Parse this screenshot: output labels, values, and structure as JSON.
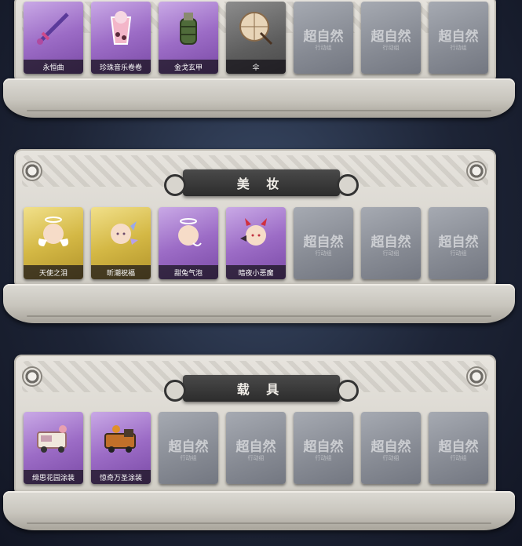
{
  "sections": [
    {
      "title": "",
      "items": [
        {
          "label": "永恒曲",
          "rarity": "purple",
          "icon": "sword-icon"
        },
        {
          "label": "珍珠音乐卷卷",
          "rarity": "purple",
          "icon": "drink-cup-icon"
        },
        {
          "label": "金戈玄甲",
          "rarity": "purple",
          "icon": "grenade-icon"
        },
        {
          "label": "伞",
          "rarity": "grey",
          "icon": "umbrella-icon"
        },
        {
          "label": "",
          "rarity": "empty",
          "icon": "watermark-icon"
        },
        {
          "label": "",
          "rarity": "empty",
          "icon": "watermark-icon"
        },
        {
          "label": "",
          "rarity": "empty",
          "icon": "watermark-icon"
        }
      ]
    },
    {
      "title": "美 妆",
      "items": [
        {
          "label": "天使之泪",
          "rarity": "gold",
          "icon": "angel-face-icon"
        },
        {
          "label": "昕潮祝福",
          "rarity": "gold",
          "icon": "crystal-face-icon"
        },
        {
          "label": "甜兔气泡",
          "rarity": "purple",
          "icon": "bunny-face-icon"
        },
        {
          "label": "暗夜小恶魔",
          "rarity": "purple",
          "icon": "devil-face-icon"
        },
        {
          "label": "",
          "rarity": "empty",
          "icon": "watermark-icon"
        },
        {
          "label": "",
          "rarity": "empty",
          "icon": "watermark-icon"
        },
        {
          "label": "",
          "rarity": "empty",
          "icon": "watermark-icon"
        }
      ]
    },
    {
      "title": "载 具",
      "items": [
        {
          "label": "缔思花园涂装",
          "rarity": "purple",
          "icon": "food-truck-icon"
        },
        {
          "label": "惊奇万圣涂装",
          "rarity": "purple",
          "icon": "halloween-truck-icon"
        },
        {
          "label": "",
          "rarity": "empty",
          "icon": "watermark-icon"
        },
        {
          "label": "",
          "rarity": "empty",
          "icon": "watermark-icon"
        },
        {
          "label": "",
          "rarity": "empty",
          "icon": "watermark-icon"
        },
        {
          "label": "",
          "rarity": "empty",
          "icon": "watermark-icon"
        },
        {
          "label": "",
          "rarity": "empty",
          "icon": "watermark-icon"
        }
      ]
    }
  ],
  "watermark": {
    "main": "超自然",
    "sub": "行动组"
  }
}
